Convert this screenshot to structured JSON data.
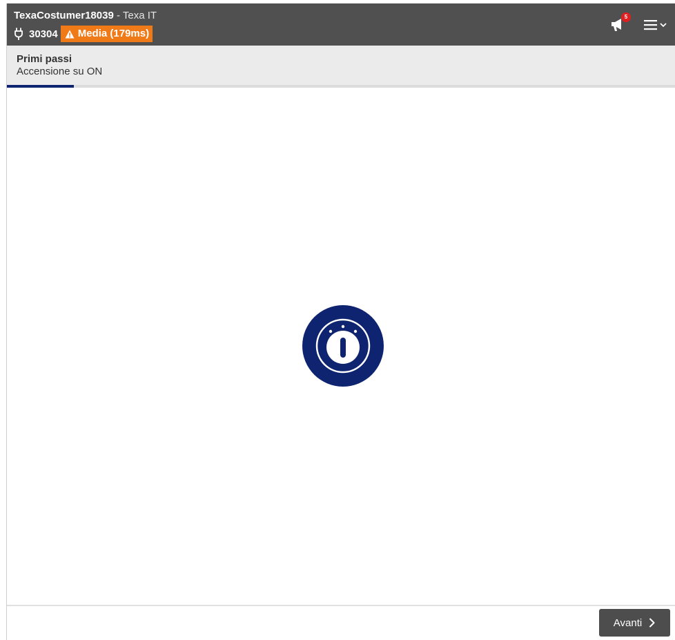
{
  "header": {
    "user": "TexaCostumer18039",
    "separator": " - ",
    "company": "Texa IT",
    "connection_id": "30304",
    "connection_quality": "Media (179ms)",
    "notification_count": "5",
    "icons": [
      "plug-icon",
      "warning-icon",
      "megaphone-icon",
      "hamburger-menu-icon",
      "chevron-down-icon"
    ],
    "badge_color": "#f07a18",
    "bar_color": "#505050"
  },
  "step": {
    "title": "Primi passi",
    "subtitle": "Accensione su ON",
    "progress": 0.1
  },
  "main": {
    "icon": "ignition-key-icon",
    "icon_color": "#0e2470"
  },
  "footer": {
    "next_label": "Avanti",
    "button_color": "#4d4d4d"
  }
}
